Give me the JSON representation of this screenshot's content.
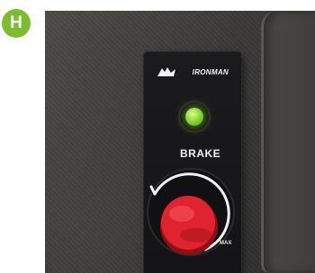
{
  "badge": {
    "letter": "H",
    "color": "#7dbb2f"
  },
  "controller": {
    "brand_logo": "IRONMAN",
    "indicator_light": {
      "state": "on",
      "color": "#8ed93a"
    },
    "label": "BRAKE",
    "dial_end_label": "MAX",
    "knob_color": "#e0242f"
  }
}
